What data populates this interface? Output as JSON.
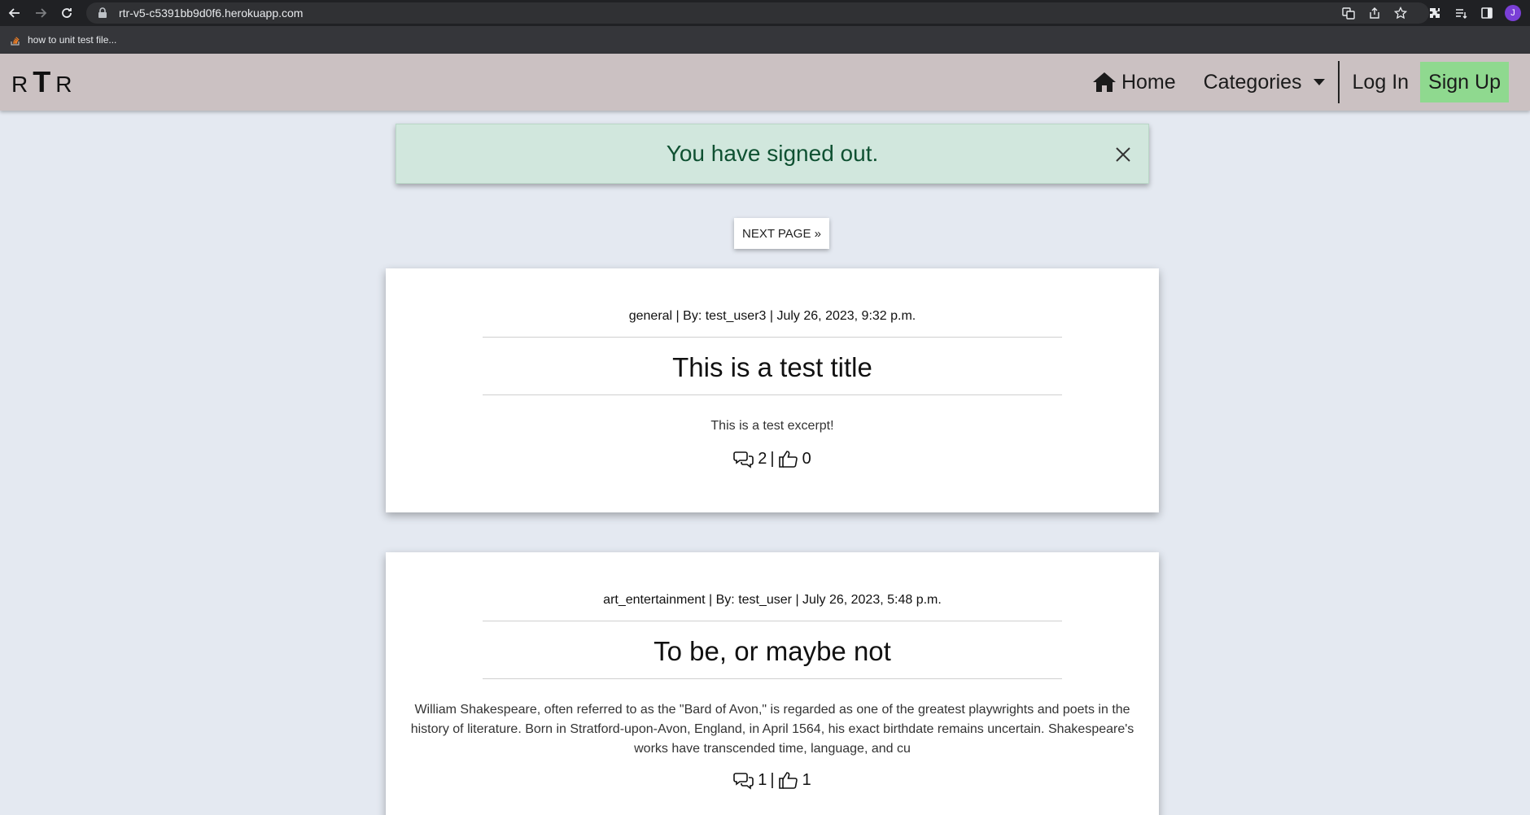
{
  "browser": {
    "url": "rtr-v5-c5391bb9d0f6.herokuapp.com",
    "bookmark_label": "how to unit test file...",
    "avatar_letter": "J"
  },
  "navbar": {
    "brand_left": "R",
    "brand_mid": "T",
    "brand_right": "R",
    "home_label": "Home",
    "categories_label": "Categories",
    "login_label": "Log In",
    "signup_label": "Sign Up"
  },
  "alert": {
    "message": "You have signed out."
  },
  "pagination": {
    "next_label": "NEXT PAGE »"
  },
  "posts": [
    {
      "meta": "general | By: test_user3 | July 26, 2023, 9:32 p.m.",
      "title": "This is a test title",
      "excerpt": "This is a test excerpt!",
      "comments": "2",
      "separator": "|",
      "likes": "0"
    },
    {
      "meta": "art_entertainment | By: test_user | July 26, 2023, 5:48 p.m.",
      "title": "To be, or maybe not",
      "excerpt": "William Shakespeare, often referred to as the \"Bard of Avon,\" is regarded as one of the greatest playwrights and poets in the history of literature. Born in Stratford-upon-Avon, England, in April 1564, his exact birthdate remains uncertain. Shakespeare's works have transcended time, language, and cu",
      "comments": "1",
      "separator": "|",
      "likes": "1"
    }
  ],
  "colors": {
    "navbar_bg": "#cbc1c2",
    "signup_bg": "#8fd98f",
    "alert_bg": "#d1e7dd",
    "alert_text": "#0f5132",
    "page_bg": "#e4e9f1"
  }
}
